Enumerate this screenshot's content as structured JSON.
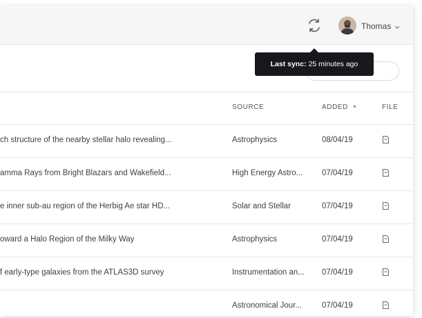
{
  "header": {
    "sync_icon": "refresh-icon",
    "user_name": "Thomas",
    "chevron_icon": "chevron-down-icon"
  },
  "tooltip": {
    "label": "Last sync:",
    "value": "25 minutes ago"
  },
  "search": {
    "value": "",
    "placeholder": ""
  },
  "table": {
    "columns": {
      "source": "SOURCE",
      "added": "ADDED",
      "file": "FILE"
    },
    "sorted_column": "added",
    "rows": [
      {
        "title": "ch structure of the nearby stellar halo revealing...",
        "source": "Astrophysics",
        "added": "08/04/19",
        "file_icon": "file-icon"
      },
      {
        "title": "amma Rays from Bright Blazars and Wakefield...",
        "source": "High Energy Astro...",
        "added": "07/04/19",
        "file_icon": "file-icon"
      },
      {
        "title": "e inner sub-au region of the Herbig Ae star HD...",
        "source": "Solar and Stellar",
        "added": "07/04/19",
        "file_icon": "file-icon"
      },
      {
        "title": "oward a Halo Region of the Milky Way",
        "source": "Astrophysics",
        "added": "07/04/19",
        "file_icon": "file-icon"
      },
      {
        "title": "f early-type galaxies from the ATLAS3D survey",
        "source": "Instrumentation an...",
        "added": "07/04/19",
        "file_icon": "file-icon"
      },
      {
        "title": "",
        "source": "Astronomical Jour...",
        "added": "07/04/19",
        "file_icon": "file-icon"
      }
    ]
  }
}
